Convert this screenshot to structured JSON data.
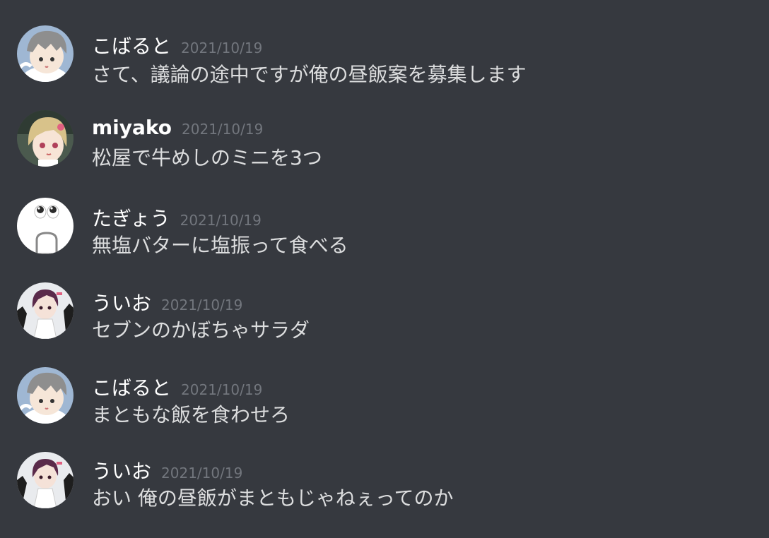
{
  "messages": [
    {
      "username": "こばると",
      "timestamp": "2021/10/19",
      "content": "さて、議論の途中ですが俺の昼飯案を募集します",
      "avatar_icon": "cobalt-avatar-icon"
    },
    {
      "username": "miyako",
      "timestamp": "2021/10/19",
      "content": "松屋で牛めしのミニを3つ",
      "avatar_icon": "miyako-avatar-icon"
    },
    {
      "username": "たぎょう",
      "timestamp": "2021/10/19",
      "content": "無塩バターに塩振って食べる",
      "avatar_icon": "tagyou-avatar-icon"
    },
    {
      "username": "ういお",
      "timestamp": "2021/10/19",
      "content": "セブンのかぼちゃサラダ",
      "avatar_icon": "uio-avatar-icon"
    },
    {
      "username": "こばると",
      "timestamp": "2021/10/19",
      "content": "まともな飯を食わせろ",
      "avatar_icon": "cobalt-avatar-icon"
    },
    {
      "username": "ういお",
      "timestamp": "2021/10/19",
      "content": "おい 俺の昼飯がまともじゃねぇってのか",
      "avatar_icon": "uio-avatar-icon"
    }
  ],
  "colors": {
    "background": "#36393f",
    "username": "#ffffff",
    "message_text": "#dcddde",
    "timestamp": "#72767d"
  }
}
